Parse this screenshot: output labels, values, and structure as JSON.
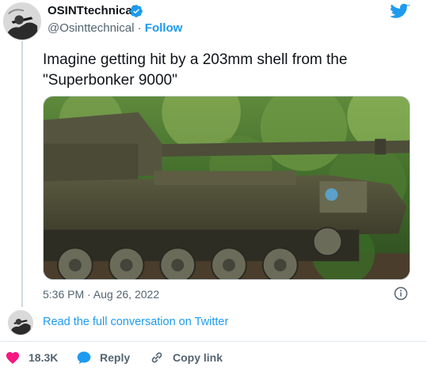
{
  "header": {
    "display_name": "OSINTtechnical",
    "handle": "@Osinttechnical",
    "separator": " · ",
    "follow_label": "Follow"
  },
  "tweet": {
    "text": "Imagine getting hit by a 203mm shell from the\n\"Superbonker 9000\"",
    "timestamp": "5:36 PM · Aug 26, 2022"
  },
  "footer": {
    "read_more": "Read the full conversation on Twitter"
  },
  "actions": {
    "likes": "18.3K",
    "reply": "Reply",
    "copy_link": "Copy link"
  },
  "colors": {
    "accent": "#1d9bf0",
    "like": "#f91880",
    "muted_text": "#536471"
  },
  "icons": [
    "verified-badge-icon",
    "twitter-bird-icon",
    "info-icon",
    "heart-icon",
    "reply-bubble-icon",
    "link-icon"
  ]
}
